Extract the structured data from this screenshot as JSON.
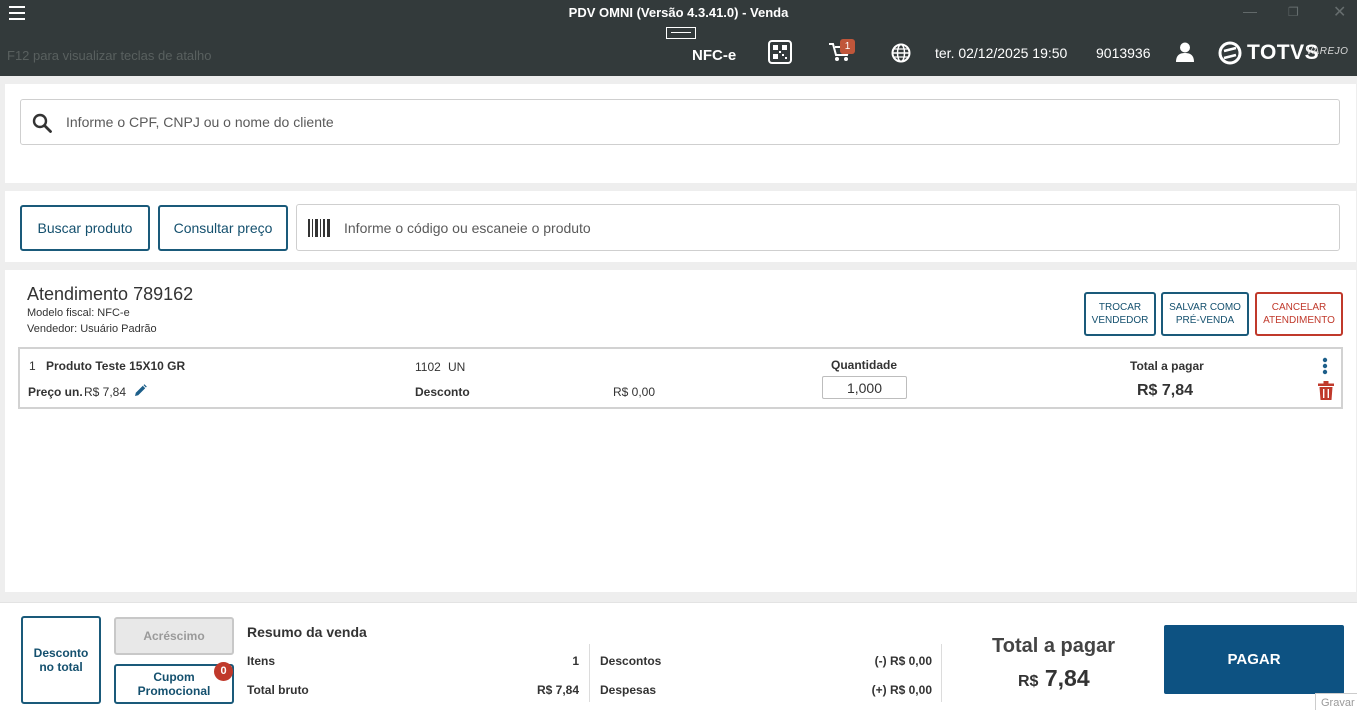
{
  "window": {
    "title": "PDV OMNI (Versão 4.3.41.0) - Venda"
  },
  "header": {
    "hint": "F12 para visualizar teclas de atalho",
    "fiscal_mode": "NFC-e",
    "cart_count": "1",
    "datetime": "ter. 02/12/2025 19:50",
    "user_code": "9013936",
    "logo_brand": "TOTVS",
    "logo_sub": "VAREJO"
  },
  "client_search": {
    "placeholder": "Informe o CPF, CNPJ ou o nome do cliente"
  },
  "product_search": {
    "search_button": "Buscar produto",
    "price_button": "Consultar preço",
    "placeholder": "Informe o código ou escaneie o produto"
  },
  "attendance": {
    "title": "Atendimento 789162",
    "fiscal_model": "Modelo fiscal: NFC-e",
    "seller": "Vendedor: Usuário Padrão",
    "actions": {
      "change_seller_l1": "TROCAR",
      "change_seller_l2": "VENDEDOR",
      "save_presale_l1": "SALVAR COMO",
      "save_presale_l2": "PRÉ-VENDA",
      "cancel_l1": "CANCELAR",
      "cancel_l2": "ATENDIMENTO"
    }
  },
  "items": [
    {
      "index": "1",
      "name": "Produto Teste 15X10 GR",
      "code": "1102",
      "unit": "UN",
      "unit_price_label": "Preço un.",
      "unit_price": "R$ 7,84",
      "discount_label": "Desconto",
      "discount": "R$ 0,00",
      "quantity_label": "Quantidade",
      "quantity": "1,000",
      "total_label": "Total a pagar",
      "total": "R$ 7,84"
    }
  ],
  "footer": {
    "discount_total_l1": "Desconto",
    "discount_total_l2": "no total",
    "surcharge": "Acréscimo",
    "coupon": "Cupom Promocional",
    "coupon_count": "0",
    "summary_title": "Resumo da venda",
    "items_label": "Itens",
    "items_value": "1",
    "gross_label": "Total bruto",
    "gross_value": "R$ 7,84",
    "discounts_label": "Descontos",
    "discounts_value": "(-) R$ 0,00",
    "expenses_label": "Despesas",
    "expenses_value": "(+) R$ 0,00",
    "total_label": "Total a pagar",
    "total_currency": "R$",
    "total_value": "7,84",
    "pay_button": "PAGAR",
    "record_label": "Gravar"
  },
  "colors": {
    "header_bg": "#333a3b",
    "primary": "#0d5282",
    "outline": "#1a5a7a",
    "danger": "#c0392b"
  }
}
